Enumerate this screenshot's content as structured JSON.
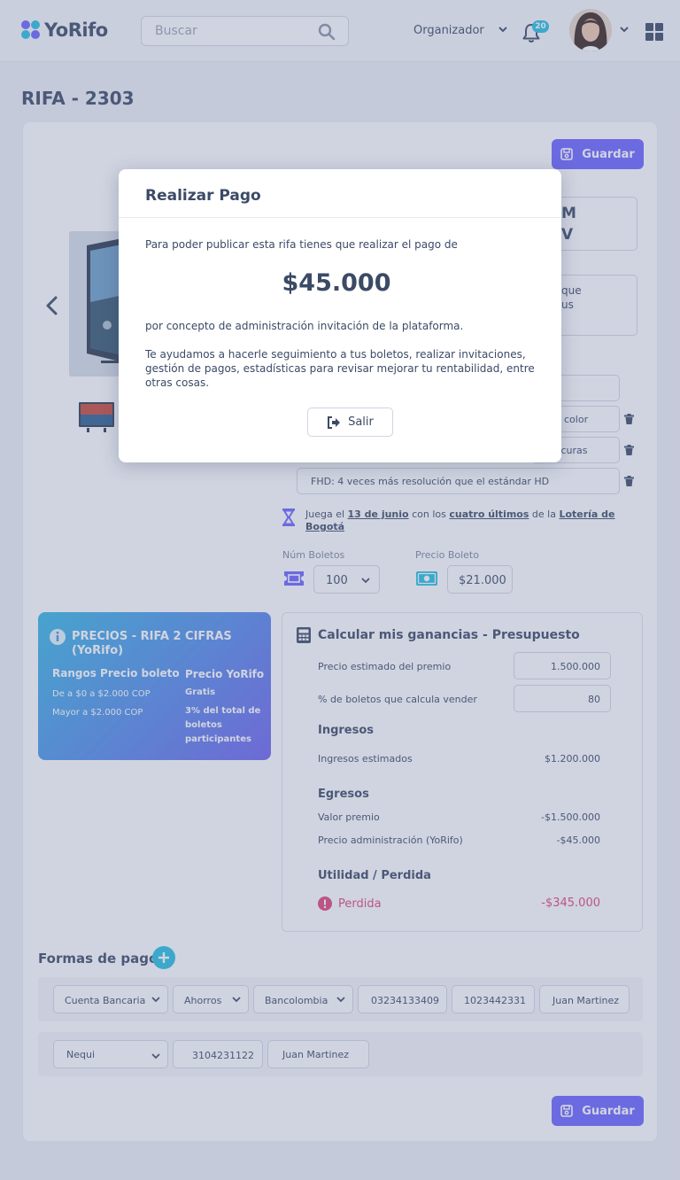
{
  "header": {
    "logo_text": "YoRifo",
    "search_placeholder": "Buscar",
    "role": "Organizador",
    "notifications_count": "20"
  },
  "page": {
    "title": "RIFA - 2303"
  },
  "actions": {
    "save_label": "Guardar"
  },
  "product": {
    "title_partial": [
      "M",
      "V"
    ],
    "description_partial": [
      "que",
      "us"
    ],
    "features": [
      {
        "text": "color"
      },
      {
        "text": "oscuras"
      },
      {
        "text": "FHD: 4 veces más resolución que el estándar HD"
      }
    ]
  },
  "lottery": {
    "prefix": "Juega el",
    "date": "13 de junio",
    "mid": "con los",
    "digits": "cuatro últimos",
    "mid2": "de la",
    "lottery_name": "Lotería de Bogotá"
  },
  "tickets": {
    "count_label": "Núm Boletos",
    "count_value": "100",
    "price_label": "Precio Boleto",
    "price_value": "$21.000"
  },
  "prices_info": {
    "title": "PRECIOS - RIFA 2 CIFRAS (YoRifo)",
    "col1_head": "Rangos Precio boleto",
    "col1_rows": [
      "De a $0 a $2.000 COP",
      "Mayor a $2.000 COP"
    ],
    "col2_head": "Precio YoRifo",
    "col2_rows": [
      "Gratis",
      "3% del total de boletos participantes"
    ]
  },
  "calc": {
    "title": "Calcular mis ganancias - Presupuesto",
    "prize_label": "Precio estimado del premio",
    "prize_value": "1.500.000",
    "percent_label": "% de boletos que calcula vender",
    "percent_value": "80",
    "income_head": "Ingresos",
    "income_label": "Ingresos estimados",
    "income_value": "$1.200.000",
    "expense_head": "Egresos",
    "expense_prize_label": "Valor premio",
    "expense_prize_value": "-$1.500.000",
    "expense_admin_label": "Precio administración (YoRifo)",
    "expense_admin_value": "-$45.000",
    "result_head": "Utilidad / Perdida",
    "result_label": "Perdida",
    "result_value": "-$345.000",
    "loss_color": "#e0457b"
  },
  "payments": {
    "title": "Formas de pago",
    "rows": [
      {
        "type": "Cuenta Bancaria",
        "account_type": "Ahorros",
        "bank": "Bancolombia",
        "number": "03234133409",
        "id": "1023442331",
        "holder": "Juan Martinez"
      },
      {
        "type": "Nequi",
        "number": "3104231122",
        "holder": "Juan Martinez"
      }
    ]
  },
  "modal": {
    "title": "Realizar Pago",
    "intro": "Para poder publicar esta rifa tienes que realizar el pago de",
    "amount": "$45.000",
    "concept": "por concepto de administración invitación de la plataforma.",
    "help": "Te ayudamos a hacerle seguimiento a tus boletos, realizar invitaciones, gestión de pagos, estadísticas para revisar mejorar tu rentabilidad, entre otras cosas.",
    "exit_label": "Salir"
  },
  "colors": {
    "primary": "#6c63ff",
    "accent": "#25c0e0",
    "text": "#3b4a66"
  }
}
